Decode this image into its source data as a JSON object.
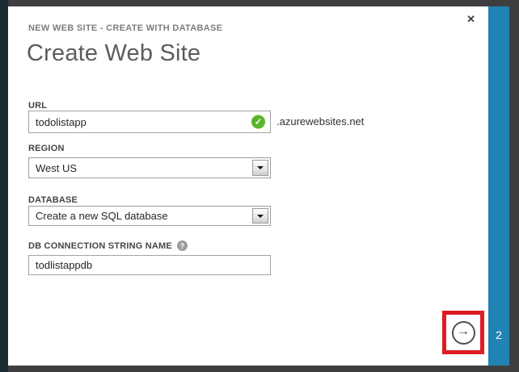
{
  "window": {
    "breadcrumb": "NEW WEB SITE - CREATE WITH DATABASE",
    "title": "Create Web Site",
    "close_icon": "✕"
  },
  "form": {
    "url": {
      "label": "URL",
      "value": "todolistapp",
      "suffix": ".azurewebsites.net",
      "valid_check_icon": "✓"
    },
    "region": {
      "label": "REGION",
      "selected": "West US"
    },
    "database": {
      "label": "DATABASE",
      "selected": "Create a new SQL database"
    },
    "db_connection_string": {
      "label": "DB CONNECTION STRING NAME",
      "help_icon": "?",
      "value": "todlistappdb"
    }
  },
  "footer": {
    "next_button_icon": "→",
    "step_indicator": "2"
  },
  "colors": {
    "rail_blue": "#2183b4",
    "valid_green": "#5bb42d",
    "annotation_red": "#e01b24",
    "frame_gray": "#3e3e40",
    "backdrop_navy": "#1c2a32"
  }
}
